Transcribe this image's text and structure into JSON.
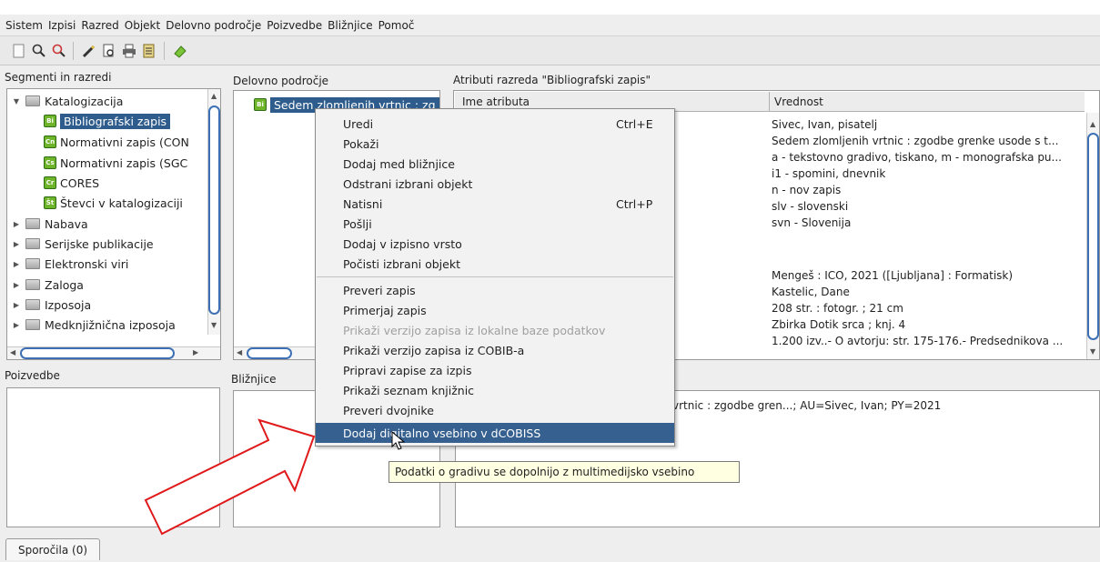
{
  "menu": [
    "Sistem",
    "Izpisi",
    "Razred",
    "Objekt",
    "Delovno področje",
    "Poizvedbe",
    "Bližnjice",
    "Pomoč"
  ],
  "toolbar_icons": [
    "new-document-icon",
    "search-icon",
    "search-red-icon",
    "pencil-icon",
    "print-preview-icon",
    "printer-icon",
    "notes-icon",
    "eraser-icon"
  ],
  "panes": {
    "segments_title": "Segmenti in razredi",
    "workspace_title": "Delovno področje",
    "attributes_title": "Atributi razreda \"Bibliografski zapis\"",
    "queries_title": "Poizvedbe",
    "shortcuts_title": "Bližnjice"
  },
  "tree": {
    "katalogizacija": "Katalogizacija",
    "children": [
      {
        "badge": "Bi",
        "label": "Bibliografski zapis"
      },
      {
        "badge": "Cn",
        "label": "Normativni zapis (CON"
      },
      {
        "badge": "Cs",
        "label": "Normativni zapis (SGC"
      },
      {
        "badge": "Cr",
        "label": "CORES"
      },
      {
        "badge": "Št",
        "label": "Števci v katalogizaciji"
      }
    ],
    "folders": [
      "Nabava",
      "Serijske publikacije",
      "Elektronski viri",
      "Zaloga",
      "Izposoja",
      "Medknjižnična izposoja"
    ]
  },
  "workspace_item": {
    "badge": "Bi",
    "label": "Sedem zlomljenih vrtnic : zg"
  },
  "attributes": {
    "col_name": "Ime atributa",
    "col_value": "Vrednost",
    "values": [
      "Sivec, Ivan, pisatelj",
      "Sedem zlomljenih vrtnic : zgodbe grenke usode s t...",
      "a - tekstovno gradivo, tiskano, m - monografska pu...",
      "i1 - spomini, dnevnik",
      "n - nov zapis",
      "slv - slovenski",
      "svn  -  Slovenija",
      "",
      "",
      "Mengeš : ICO, 2021 ([Ljubljana] : Formatisk)",
      "Kastelic, Dane",
      "208 str. : fotogr. ; 21 cm",
      "Zbirka Dotik srca ; knj. 4",
      "1.200 izv..- O avtorju: str. 175-176.- Predsednikova ..."
    ]
  },
  "shortcut_text": "vrtnic : zgodbe gren...; AU=Sivec, Ivan; PY=2021",
  "context_menu": [
    {
      "label": "Uredi",
      "accel": "Ctrl+E"
    },
    {
      "label": "Pokaži",
      "accel": ""
    },
    {
      "label": "Dodaj med bližnjice",
      "accel": ""
    },
    {
      "label": "Odstrani izbrani objekt",
      "accel": ""
    },
    {
      "label": "Natisni",
      "accel": "Ctrl+P"
    },
    {
      "label": "Pošlji",
      "accel": ""
    },
    {
      "label": "Dodaj v izpisno vrsto",
      "accel": ""
    },
    {
      "label": "Počisti izbrani objekt",
      "accel": ""
    },
    {
      "label": "Preveri zapis",
      "accel": ""
    },
    {
      "label": "Primerjaj zapis",
      "accel": ""
    },
    {
      "label": "Prikaži verzijo zapisa iz lokalne baze podatkov",
      "accel": ""
    },
    {
      "label": "Prikaži verzijo zapisa iz COBIB-a",
      "accel": ""
    },
    {
      "label": "Pripravi zapise za izpis",
      "accel": ""
    },
    {
      "label": "Prikaži seznam knjižnic",
      "accel": ""
    },
    {
      "label": "Preveri dvojnike",
      "accel": ""
    },
    {
      "label": "Dodaj digitalno vsebino v dCOBISS",
      "accel": ""
    }
  ],
  "tooltip": "Podatki o gradivu se dopolnijo z multimedijsko vsebino",
  "messages_tab": "Sporočila (0)",
  "colors": {
    "selection": "#2e5c8c",
    "menu_highlight": "#35608f",
    "arrow": "#e0191b",
    "badge": "#6fb52b"
  }
}
